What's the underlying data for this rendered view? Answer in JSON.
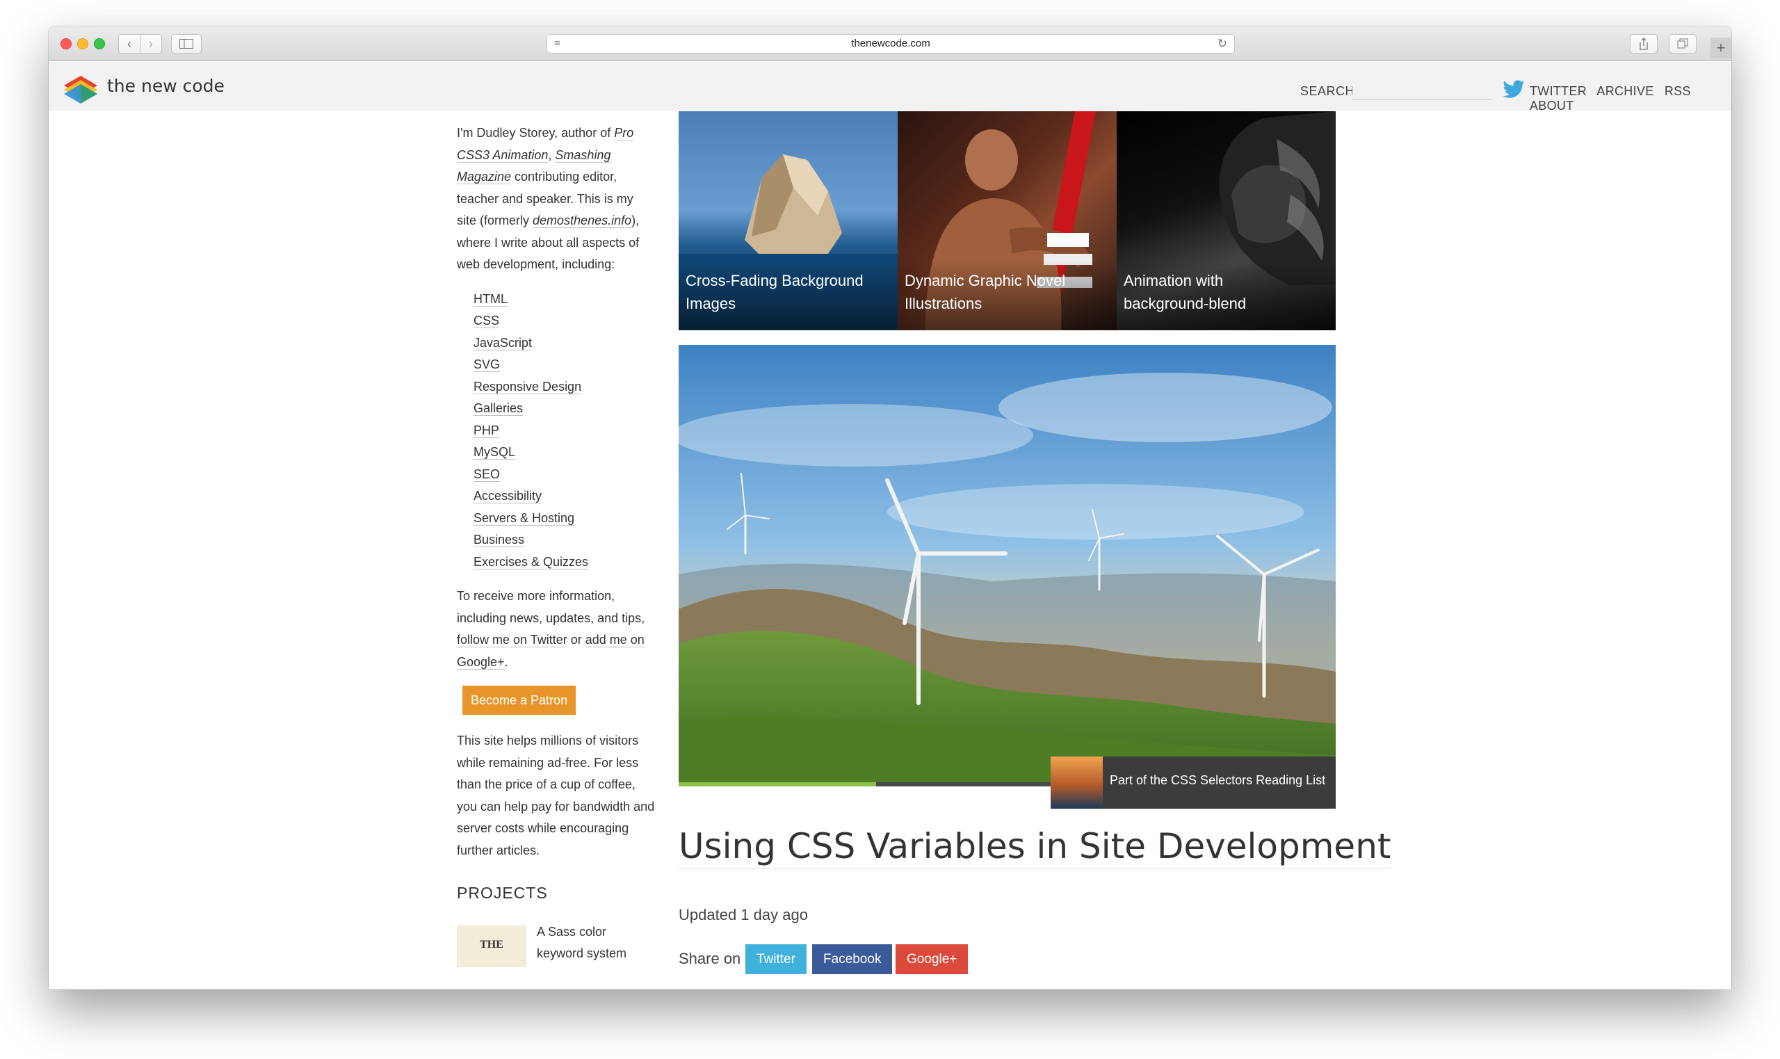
{
  "browser": {
    "url": "thenewcode.com"
  },
  "header": {
    "brand": "the new code",
    "search_label": "SEARCH",
    "nav": [
      "TWITTER",
      "ARCHIVE",
      "RSS",
      "ABOUT"
    ]
  },
  "sidebar": {
    "bio_1": "I'm Dudley Storey, author of ",
    "bio_em_1": "Pro CSS3 Animation",
    "bio_2": ", ",
    "bio_em_2": "Smashing Magazine",
    "bio_3": " contributing editor, teacher and speaker. This is my site (formerly ",
    "bio_em_3": "demosthenes.info",
    "bio_4": "), where I write about all aspects of web development, including:",
    "topics": [
      "HTML",
      "CSS",
      "JavaScript",
      "SVG",
      "Responsive Design",
      "Galleries",
      "PHP",
      "MySQL",
      "SEO",
      "Accessibility",
      "Servers & Hosting",
      "Business",
      "Exercises & Quizzes"
    ],
    "info_1": "To receive more information, including news, updates, and tips, ",
    "info_link_1": "follow me on Twitter",
    "info_2": " or ",
    "info_link_2": "add me on Google+",
    "info_3": ".",
    "patron_label": "Become a Patron",
    "support_text": "This site helps millions of visitors while remaining ad-free. For less than the price of a cup of coffee, you can help pay for bandwidth and server costs while encouraging further articles.",
    "projects_title": "PROJECTS",
    "project_thumb_text": "THE",
    "project_text": "A Sass color keyword system"
  },
  "tiles": [
    {
      "line1": "Cross-Fading Background",
      "line2": "Images"
    },
    {
      "line1": "Dynamic Graphic Novel",
      "line2": "Illustrations"
    },
    {
      "line1": "Animation with",
      "line2": "background-blend"
    }
  ],
  "hero": {
    "progress": 0.3,
    "reading_list": "Part of the CSS Selectors Reading List"
  },
  "article": {
    "title": "Using CSS Variables in Site Development",
    "updated": "Updated 1 day ago",
    "share_label": "Share on",
    "share_twitter": "Twitter",
    "share_facebook": "Facebook",
    "share_google": "Google+"
  },
  "colors": {
    "patron": "#e8962a",
    "twitter": "#3fb1dc",
    "facebook": "#3b5a9a",
    "google": "#db4a3a",
    "progress": "#8bc34a"
  }
}
